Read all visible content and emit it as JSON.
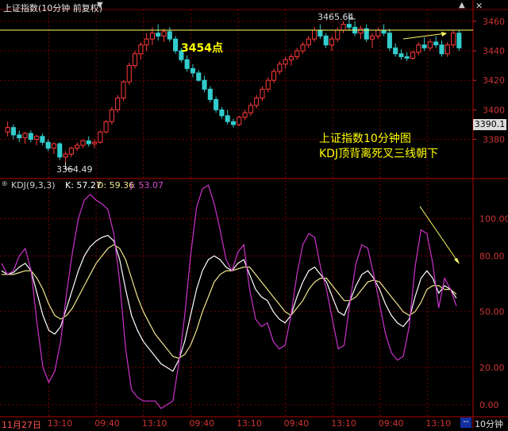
{
  "header": {
    "title": "上证指数(10分钟 前复权)",
    "kdj_label": "KDJ(9,3,3)",
    "k_label": "K: 57.27",
    "d_label": "D: 59.36",
    "j_label": "J: 53.07"
  },
  "colors": {
    "up": "#ff3a3a",
    "down": "#33cccc",
    "k": "#ffffff",
    "d": "#f0e68c",
    "j": "#cc33cc",
    "grid": "#7a0000",
    "axis_text": "#cc3333",
    "annotation": "#ffff00",
    "current_price_box": "#ffffff"
  },
  "annotations": {
    "level_label": "3454点",
    "high_label": "3465.64",
    "low_label": "3364.49",
    "note_line1": "上证指数10分钟图",
    "note_line2": "KDJ顶背离死叉三线朝下",
    "current_price": "3390.1"
  },
  "bottom_bar": {
    "date_label": "11月27日",
    "period_label": "10分钟",
    "scroll_label": "--"
  },
  "chart_data": [
    {
      "type": "candlestick",
      "title": "上证指数(10分钟 前复权)",
      "y_ticks": [
        3380,
        3400,
        3420,
        3440,
        3460
      ],
      "ylim": [
        3355,
        3468
      ],
      "annotated_high": 3465.64,
      "annotated_low": 3364.49,
      "reference_level": 3454,
      "current_price": 3390.1,
      "x_tick_labels": [
        "11月27日",
        "13:10",
        "09:40",
        "13:10",
        "09:40",
        "13:10",
        "09:40",
        "13:10",
        "09:40",
        "13:10"
      ],
      "grid": true,
      "candles": [
        {
          "o": 3385,
          "h": 3392,
          "l": 3382,
          "c": 3388
        },
        {
          "o": 3388,
          "h": 3390,
          "l": 3380,
          "c": 3383
        },
        {
          "o": 3383,
          "h": 3386,
          "l": 3378,
          "c": 3381
        },
        {
          "o": 3381,
          "h": 3385,
          "l": 3377,
          "c": 3384
        },
        {
          "o": 3384,
          "h": 3386,
          "l": 3378,
          "c": 3380
        },
        {
          "o": 3380,
          "h": 3383,
          "l": 3376,
          "c": 3382
        },
        {
          "o": 3382,
          "h": 3384,
          "l": 3376,
          "c": 3378
        },
        {
          "o": 3378,
          "h": 3380,
          "l": 3372,
          "c": 3374
        },
        {
          "o": 3374,
          "h": 3378,
          "l": 3370,
          "c": 3377
        },
        {
          "o": 3377,
          "h": 3378,
          "l": 3366,
          "c": 3368
        },
        {
          "o": 3368,
          "h": 3372,
          "l": 3364.49,
          "c": 3370
        },
        {
          "o": 3370,
          "h": 3375,
          "l": 3368,
          "c": 3374
        },
        {
          "o": 3374,
          "h": 3378,
          "l": 3372,
          "c": 3376
        },
        {
          "o": 3376,
          "h": 3380,
          "l": 3374,
          "c": 3379
        },
        {
          "o": 3379,
          "h": 3382,
          "l": 3375,
          "c": 3377
        },
        {
          "o": 3377,
          "h": 3380,
          "l": 3374,
          "c": 3378
        },
        {
          "o": 3378,
          "h": 3386,
          "l": 3377,
          "c": 3385
        },
        {
          "o": 3385,
          "h": 3393,
          "l": 3384,
          "c": 3392
        },
        {
          "o": 3392,
          "h": 3402,
          "l": 3390,
          "c": 3400
        },
        {
          "o": 3400,
          "h": 3410,
          "l": 3398,
          "c": 3408
        },
        {
          "o": 3408,
          "h": 3420,
          "l": 3406,
          "c": 3419
        },
        {
          "o": 3419,
          "h": 3432,
          "l": 3417,
          "c": 3430
        },
        {
          "o": 3430,
          "h": 3440,
          "l": 3428,
          "c": 3438
        },
        {
          "o": 3438,
          "h": 3446,
          "l": 3434,
          "c": 3444
        },
        {
          "o": 3444,
          "h": 3452,
          "l": 3440,
          "c": 3448
        },
        {
          "o": 3448,
          "h": 3456,
          "l": 3444,
          "c": 3452
        },
        {
          "o": 3452,
          "h": 3458,
          "l": 3447,
          "c": 3450
        },
        {
          "o": 3450,
          "h": 3455,
          "l": 3446,
          "c": 3453
        },
        {
          "o": 3453,
          "h": 3456,
          "l": 3446,
          "c": 3448
        },
        {
          "o": 3448,
          "h": 3450,
          "l": 3438,
          "c": 3440
        },
        {
          "o": 3440,
          "h": 3442,
          "l": 3432,
          "c": 3434
        },
        {
          "o": 3434,
          "h": 3437,
          "l": 3426,
          "c": 3428
        },
        {
          "o": 3428,
          "h": 3431,
          "l": 3422,
          "c": 3425
        },
        {
          "o": 3425,
          "h": 3427,
          "l": 3419,
          "c": 3420
        },
        {
          "o": 3420,
          "h": 3423,
          "l": 3412,
          "c": 3414
        },
        {
          "o": 3414,
          "h": 3416,
          "l": 3405,
          "c": 3407
        },
        {
          "o": 3407,
          "h": 3409,
          "l": 3398,
          "c": 3400
        },
        {
          "o": 3400,
          "h": 3402,
          "l": 3394,
          "c": 3396
        },
        {
          "o": 3396,
          "h": 3400,
          "l": 3390,
          "c": 3392
        },
        {
          "o": 3392,
          "h": 3394,
          "l": 3388,
          "c": 3390
        },
        {
          "o": 3390,
          "h": 3396,
          "l": 3389,
          "c": 3395
        },
        {
          "o": 3395,
          "h": 3400,
          "l": 3393,
          "c": 3398
        },
        {
          "o": 3398,
          "h": 3405,
          "l": 3396,
          "c": 3403
        },
        {
          "o": 3403,
          "h": 3410,
          "l": 3401,
          "c": 3408
        },
        {
          "o": 3408,
          "h": 3416,
          "l": 3406,
          "c": 3414
        },
        {
          "o": 3414,
          "h": 3422,
          "l": 3412,
          "c": 3420
        },
        {
          "o": 3420,
          "h": 3428,
          "l": 3418,
          "c": 3426
        },
        {
          "o": 3426,
          "h": 3433,
          "l": 3424,
          "c": 3431
        },
        {
          "o": 3431,
          "h": 3436,
          "l": 3428,
          "c": 3434
        },
        {
          "o": 3434,
          "h": 3438,
          "l": 3430,
          "c": 3436
        },
        {
          "o": 3436,
          "h": 3442,
          "l": 3434,
          "c": 3440
        },
        {
          "o": 3440,
          "h": 3446,
          "l": 3438,
          "c": 3444
        },
        {
          "o": 3444,
          "h": 3450,
          "l": 3442,
          "c": 3448
        },
        {
          "o": 3448,
          "h": 3456,
          "l": 3446,
          "c": 3454
        },
        {
          "o": 3454,
          "h": 3458,
          "l": 3448,
          "c": 3450
        },
        {
          "o": 3450,
          "h": 3452,
          "l": 3442,
          "c": 3444
        },
        {
          "o": 3444,
          "h": 3450,
          "l": 3440,
          "c": 3448
        },
        {
          "o": 3448,
          "h": 3456,
          "l": 3446,
          "c": 3454
        },
        {
          "o": 3454,
          "h": 3460,
          "l": 3452,
          "c": 3458
        },
        {
          "o": 3458,
          "h": 3465.64,
          "l": 3454,
          "c": 3456
        },
        {
          "o": 3456,
          "h": 3460,
          "l": 3450,
          "c": 3452
        },
        {
          "o": 3452,
          "h": 3457,
          "l": 3448,
          "c": 3455
        },
        {
          "o": 3455,
          "h": 3458,
          "l": 3446,
          "c": 3448
        },
        {
          "o": 3448,
          "h": 3452,
          "l": 3442,
          "c": 3450
        },
        {
          "o": 3450,
          "h": 3456,
          "l": 3448,
          "c": 3454
        },
        {
          "o": 3454,
          "h": 3458,
          "l": 3450,
          "c": 3452
        },
        {
          "o": 3452,
          "h": 3455,
          "l": 3440,
          "c": 3442
        },
        {
          "o": 3442,
          "h": 3445,
          "l": 3436,
          "c": 3438
        },
        {
          "o": 3438,
          "h": 3441,
          "l": 3434,
          "c": 3436
        },
        {
          "o": 3436,
          "h": 3439,
          "l": 3433,
          "c": 3435
        },
        {
          "o": 3435,
          "h": 3440,
          "l": 3434,
          "c": 3439
        },
        {
          "o": 3439,
          "h": 3446,
          "l": 3437,
          "c": 3444
        },
        {
          "o": 3444,
          "h": 3449,
          "l": 3440,
          "c": 3442
        },
        {
          "o": 3442,
          "h": 3448,
          "l": 3440,
          "c": 3446
        },
        {
          "o": 3446,
          "h": 3450,
          "l": 3442,
          "c": 3444
        },
        {
          "o": 3444,
          "h": 3447,
          "l": 3436,
          "c": 3438
        },
        {
          "o": 3438,
          "h": 3446,
          "l": 3436,
          "c": 3444
        },
        {
          "o": 3444,
          "h": 3454,
          "l": 3442,
          "c": 3452
        },
        {
          "o": 3452,
          "h": 3454,
          "l": 3440,
          "c": 3442
        }
      ]
    },
    {
      "type": "line",
      "title": "KDJ(9,3,3)",
      "y_ticks": [
        0,
        20,
        50,
        80,
        100
      ],
      "ylim": [
        -6,
        116
      ],
      "grid": true,
      "series": [
        {
          "name": "K",
          "values": [
            72,
            70,
            71,
            74,
            76,
            72,
            60,
            48,
            40,
            38,
            42,
            52,
            62,
            72,
            80,
            85,
            88,
            90,
            91,
            88,
            78,
            62,
            48,
            40,
            34,
            30,
            26,
            22,
            20,
            18,
            24,
            34,
            48,
            62,
            72,
            78,
            80,
            78,
            74,
            72,
            76,
            78,
            70,
            62,
            58,
            56,
            50,
            46,
            44,
            48,
            58,
            66,
            72,
            74,
            70,
            66,
            58,
            50,
            48,
            56,
            64,
            70,
            72,
            68,
            62,
            54,
            48,
            44,
            42,
            46,
            58,
            68,
            72,
            68,
            60,
            64,
            62,
            57.27
          ]
        },
        {
          "name": "D",
          "values": [
            70,
            70,
            70,
            71,
            72,
            72,
            68,
            62,
            54,
            48,
            46,
            48,
            52,
            58,
            64,
            70,
            76,
            80,
            84,
            86,
            84,
            78,
            68,
            58,
            50,
            44,
            38,
            34,
            30,
            26,
            25,
            27,
            32,
            40,
            50,
            58,
            66,
            70,
            72,
            72,
            73,
            74,
            74,
            70,
            66,
            62,
            58,
            54,
            50,
            48,
            52,
            56,
            62,
            66,
            68,
            68,
            64,
            60,
            56,
            56,
            58,
            62,
            66,
            67,
            66,
            62,
            58,
            54,
            50,
            48,
            50,
            55,
            62,
            64,
            64,
            62,
            62,
            59.36
          ]
        },
        {
          "name": "J",
          "values": [
            76,
            70,
            72,
            80,
            84,
            72,
            44,
            20,
            12,
            18,
            34,
            60,
            82,
            100,
            110,
            113,
            110,
            108,
            105,
            92,
            66,
            30,
            8,
            4,
            2,
            2,
            2,
            -2,
            0,
            2,
            22,
            48,
            80,
            106,
            116,
            118,
            108,
            94,
            78,
            72,
            82,
            86,
            62,
            46,
            42,
            44,
            34,
            30,
            32,
            48,
            70,
            86,
            92,
            90,
            74,
            62,
            46,
            30,
            32,
            56,
            76,
            86,
            84,
            70,
            54,
            38,
            28,
            24,
            26,
            42,
            74,
            94,
            92,
            76,
            52,
            68,
            62,
            53.07
          ]
        }
      ]
    }
  ]
}
